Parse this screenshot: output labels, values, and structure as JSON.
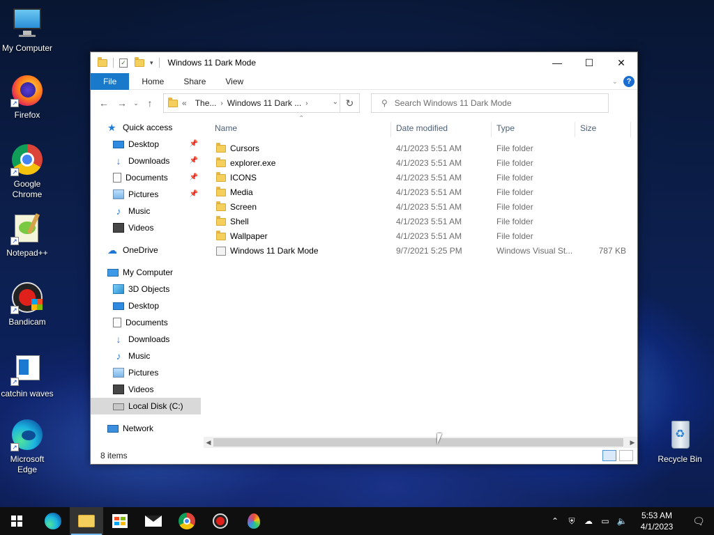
{
  "desktop": {
    "icons": [
      {
        "label": "My Computer"
      },
      {
        "label": "Firefox"
      },
      {
        "label": "Google Chrome"
      },
      {
        "label": "Notepad++"
      },
      {
        "label": "Bandicam"
      },
      {
        "label": "catchin waves"
      },
      {
        "label": "Microsoft Edge"
      },
      {
        "label": "Recycle Bin"
      }
    ]
  },
  "window": {
    "title": "Windows 11 Dark Mode",
    "controls": {
      "minimize": "—",
      "maximize": "☐",
      "close": "✕"
    },
    "ribbon_tabs": [
      "File",
      "Home",
      "Share",
      "View"
    ],
    "address": {
      "crumbs": [
        "The...",
        "Windows 11 Dark ..."
      ],
      "overflow": "«"
    },
    "search": {
      "placeholder": "Search Windows 11 Dark Mode"
    },
    "nav_pane": {
      "quick_access": {
        "label": "Quick access",
        "items": [
          {
            "label": "Desktop",
            "icon": "desktop-icon",
            "pinned": true
          },
          {
            "label": "Downloads",
            "icon": "downloads-icon",
            "pinned": true
          },
          {
            "label": "Documents",
            "icon": "documents-icon",
            "pinned": true
          },
          {
            "label": "Pictures",
            "icon": "pictures-icon",
            "pinned": true
          },
          {
            "label": "Music",
            "icon": "music-icon",
            "pinned": false
          },
          {
            "label": "Videos",
            "icon": "videos-icon",
            "pinned": false
          }
        ]
      },
      "onedrive": "OneDrive",
      "my_computer": {
        "label": "My Computer",
        "items": [
          {
            "label": "3D Objects"
          },
          {
            "label": "Desktop"
          },
          {
            "label": "Documents"
          },
          {
            "label": "Downloads"
          },
          {
            "label": "Music"
          },
          {
            "label": "Pictures"
          },
          {
            "label": "Videos"
          },
          {
            "label": "Local Disk (C:)",
            "selected": true
          }
        ]
      },
      "network": "Network"
    },
    "columns": [
      "Name",
      "Date modified",
      "Type",
      "Size"
    ],
    "files": [
      {
        "name": "Cursors",
        "date": "4/1/2023 5:51 AM",
        "type": "File folder",
        "size": ""
      },
      {
        "name": "explorer.exe",
        "date": "4/1/2023 5:51 AM",
        "type": "File folder",
        "size": ""
      },
      {
        "name": "ICONS",
        "date": "4/1/2023 5:51 AM",
        "type": "File folder",
        "size": ""
      },
      {
        "name": "Media",
        "date": "4/1/2023 5:51 AM",
        "type": "File folder",
        "size": ""
      },
      {
        "name": "Screen",
        "date": "4/1/2023 5:51 AM",
        "type": "File folder",
        "size": ""
      },
      {
        "name": "Shell",
        "date": "4/1/2023 5:51 AM",
        "type": "File folder",
        "size": ""
      },
      {
        "name": "Wallpaper",
        "date": "4/1/2023 5:51 AM",
        "type": "File folder",
        "size": ""
      },
      {
        "name": "Windows 11 Dark Mode",
        "date": "9/7/2021 5:25 PM",
        "type": "Windows Visual St...",
        "size": "787 KB"
      }
    ],
    "status": "8 items"
  },
  "taskbar": {
    "apps": [
      "start",
      "edge",
      "file-explorer",
      "store",
      "mail",
      "chrome",
      "bandicam",
      "paint"
    ],
    "time": "5:53 AM",
    "date": "4/1/2023"
  }
}
